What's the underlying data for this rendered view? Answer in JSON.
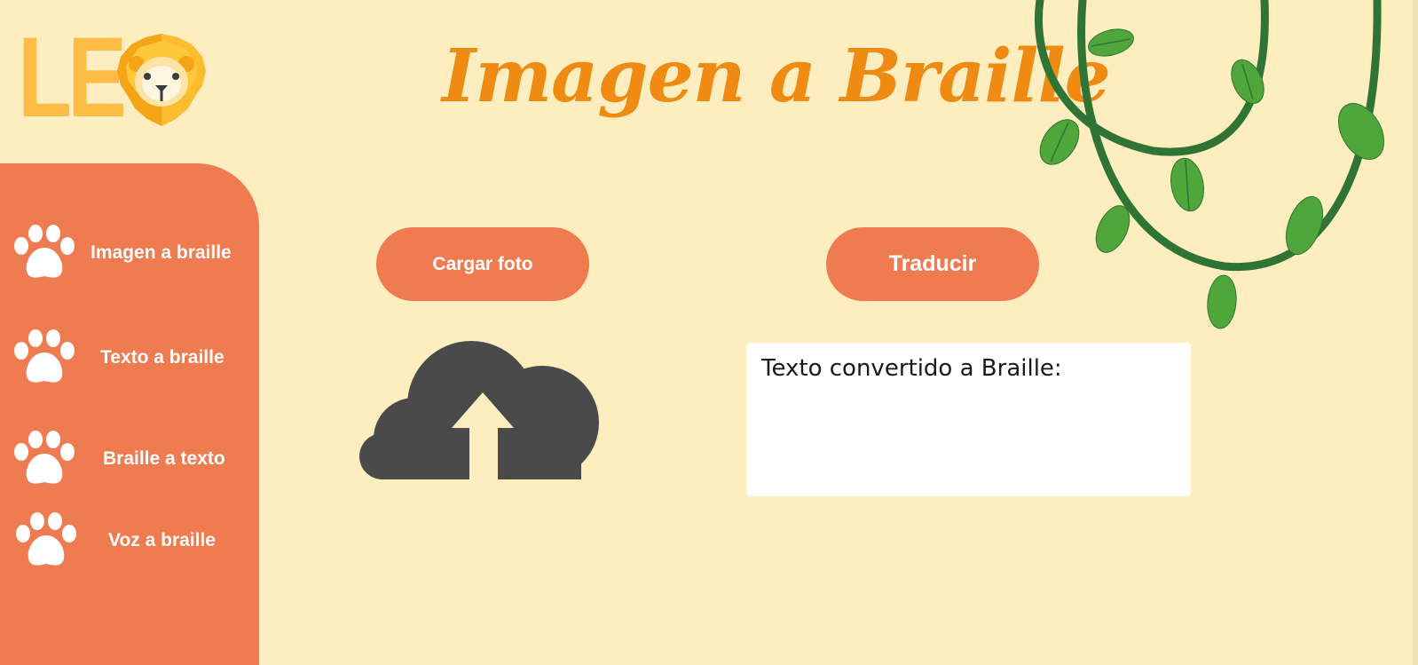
{
  "logo": {
    "text": "LE",
    "icon": "lion-icon"
  },
  "page": {
    "title": "Imagen a Braille"
  },
  "sidebar": {
    "items": [
      {
        "label": "Imagen a braille",
        "icon": "paw-icon"
      },
      {
        "label": "Texto a braille",
        "icon": "paw-icon"
      },
      {
        "label": "Braille a texto",
        "icon": "paw-icon"
      },
      {
        "label": "Voz a braille",
        "icon": "paw-icon"
      }
    ]
  },
  "actions": {
    "upload_label": "Cargar foto",
    "translate_label": "Traducir"
  },
  "upload": {
    "icon": "cloud-upload-icon"
  },
  "output": {
    "label": "Texto convertido a Braille:"
  },
  "colors": {
    "background": "#fdedbf",
    "accent": "#ef7b50",
    "title": "#ef8a12",
    "logo": "#fdbc44",
    "vine": "#2f7434",
    "leaf": "#4fa63a",
    "icon_dark": "#4a4a4a"
  }
}
